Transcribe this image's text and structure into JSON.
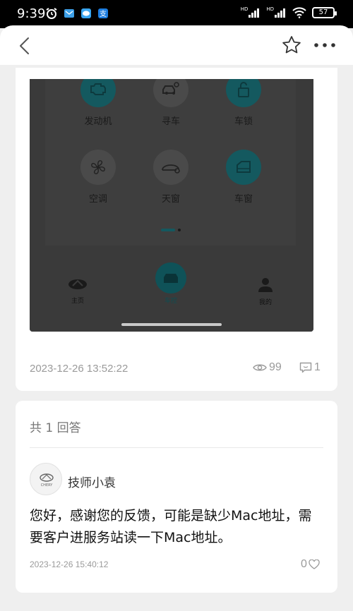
{
  "status_bar": {
    "time": "9:39",
    "battery": "57",
    "signal_label_1": "HD",
    "signal_label_2": "HD"
  },
  "header": {
    "back_icon": "chevron-left-icon",
    "favorite_icon": "star-outline-icon",
    "more_icon": "more-dots-icon"
  },
  "post": {
    "screenshot": {
      "controls": [
        {
          "label": "发动机",
          "icon": "engine-icon",
          "active": true
        },
        {
          "label": "寻车",
          "icon": "find-car-icon",
          "active": false
        },
        {
          "label": "车锁",
          "icon": "lock-icon",
          "active": true
        },
        {
          "label": "空调",
          "icon": "fan-icon",
          "active": false
        },
        {
          "label": "天窗",
          "icon": "sunroof-icon",
          "active": false
        },
        {
          "label": "车窗",
          "icon": "window-icon",
          "active": true
        }
      ],
      "nav": [
        {
          "label": "主页",
          "icon": "chery-logo-icon"
        },
        {
          "label": "车控",
          "icon": "car-icon"
        },
        {
          "label": "我的",
          "icon": "user-icon"
        }
      ]
    },
    "date": "2023-12-26 13:52:22",
    "views": "99",
    "comments": "1"
  },
  "answers": {
    "count_label": "共 1 回答",
    "items": [
      {
        "author": "技师小袁",
        "avatar_text": "CHERY",
        "text": "您好，感谢您的反馈，可能是缺少Mac地址，需要客户进服务站读一下Mac地址。",
        "date": "2023-12-26 15:40:12",
        "likes": "0"
      }
    ]
  },
  "colors": {
    "accent_teal": "#14595f",
    "muted_text": "#9a9a9a",
    "page_bg": "#efefef"
  }
}
